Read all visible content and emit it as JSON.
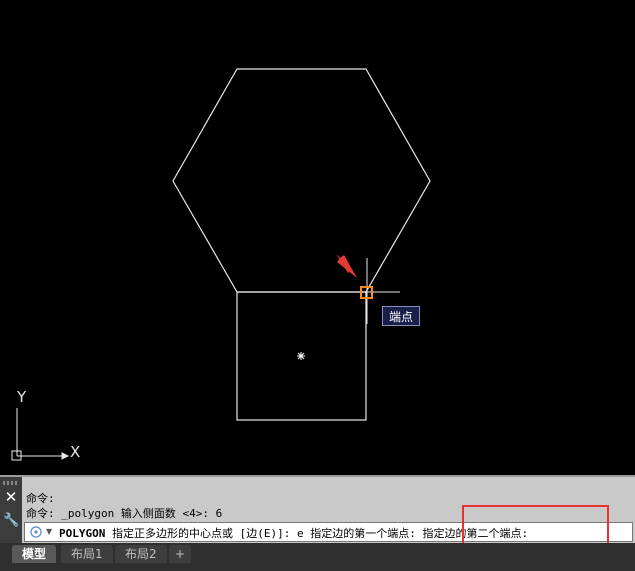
{
  "viewport": {
    "tooltip_label": "端点",
    "ucs_x_label": "X",
    "ucs_y_label": "Y",
    "colors": {
      "background": "#000000",
      "geometry": "#ffffff",
      "snap_marker": "#ff8c1a",
      "pointer": "#e53935"
    }
  },
  "command_line": {
    "history": [
      "命令:",
      "命令: _polygon 输入侧面数 <4>: 6"
    ],
    "current_command": "POLYGON",
    "prompt": " 指定正多边形的中心点或 [边(E)]: e 指定边的第一个端点: 指定边的第二个端点:",
    "close_icon": "close-icon",
    "customize_icon": "wrench-icon"
  },
  "tabs": [
    {
      "label": "模型",
      "active": true
    },
    {
      "label": "布局1",
      "active": false
    },
    {
      "label": "布局2",
      "active": false
    },
    {
      "label": "+",
      "active": false
    }
  ]
}
